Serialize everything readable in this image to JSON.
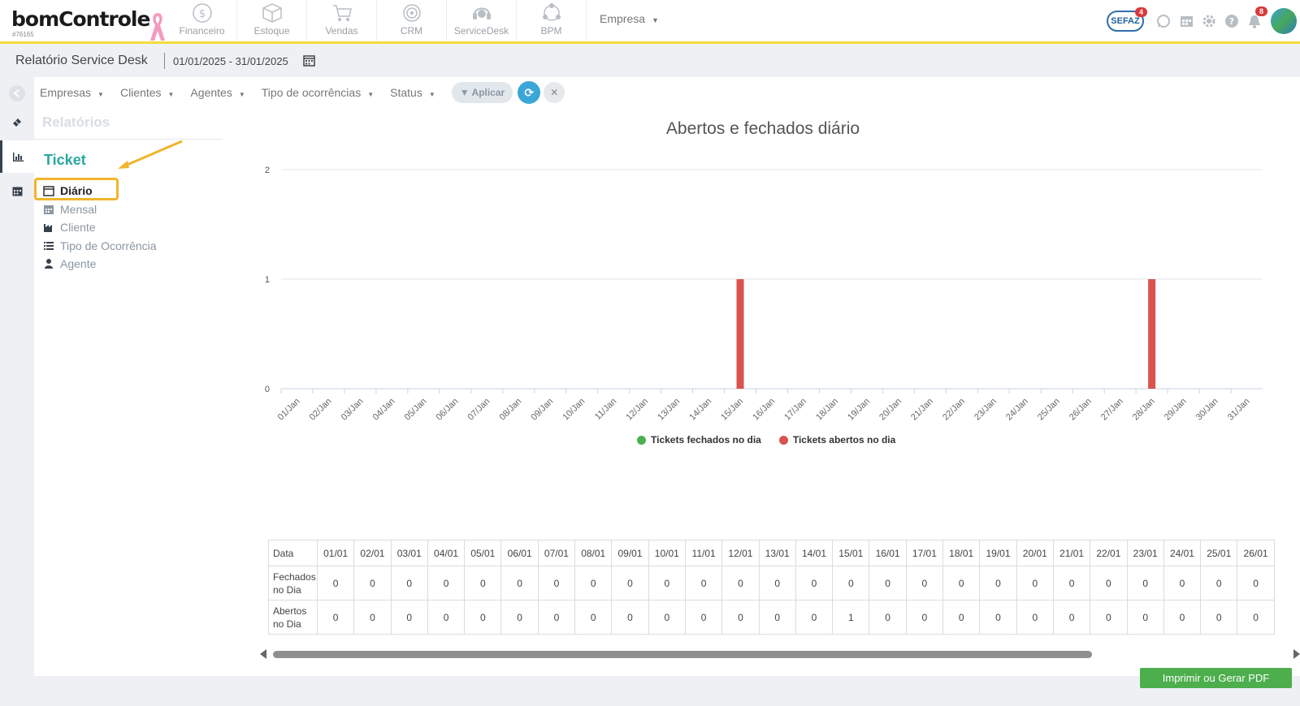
{
  "brand": {
    "logo": "bomControle",
    "account_id": "#76165"
  },
  "modules": [
    {
      "label": "Financeiro",
      "icon": "dollar-circle-icon"
    },
    {
      "label": "Estoque",
      "icon": "box-icon"
    },
    {
      "label": "Vendas",
      "icon": "cart-icon"
    },
    {
      "label": "CRM",
      "icon": "target-icon"
    },
    {
      "label": "ServiceDesk",
      "icon": "headset-icon"
    },
    {
      "label": "BPM",
      "icon": "bpm-icon"
    }
  ],
  "empresa_label": "Empresa",
  "top_icons": {
    "sefaz_label": "SEFAZ",
    "sefaz_badge": "4",
    "notifications_badge": "8"
  },
  "header": {
    "title": "Relatório Service Desk",
    "date_range": "01/01/2025 - 31/01/2025"
  },
  "filters": [
    "Empresas",
    "Clientes",
    "Agentes",
    "Tipo de ocorrências",
    "Status"
  ],
  "apply_label": "Aplicar",
  "sidebar": {
    "section": "Relatórios",
    "group": "Ticket",
    "items": [
      {
        "label": "Diário",
        "icon": "calendar-day-icon",
        "active": true
      },
      {
        "label": "Mensal",
        "icon": "calendar-icon",
        "active": false
      },
      {
        "label": "Cliente",
        "icon": "industry-icon",
        "active": false
      },
      {
        "label": "Tipo de Ocorrência",
        "icon": "list-icon",
        "active": false
      },
      {
        "label": "Agente",
        "icon": "user-icon",
        "active": false
      }
    ]
  },
  "chart_data": {
    "type": "bar",
    "title": "Abertos e fechados diário",
    "categories": [
      "01/Jan",
      "02/Jan",
      "03/Jan",
      "04/Jan",
      "05/Jan",
      "06/Jan",
      "07/Jan",
      "08/Jan",
      "09/Jan",
      "10/Jan",
      "11/Jan",
      "12/Jan",
      "13/Jan",
      "14/Jan",
      "15/Jan",
      "16/Jan",
      "17/Jan",
      "18/Jan",
      "19/Jan",
      "20/Jan",
      "21/Jan",
      "22/Jan",
      "23/Jan",
      "24/Jan",
      "25/Jan",
      "26/Jan",
      "27/Jan",
      "28/Jan",
      "29/Jan",
      "30/Jan",
      "31/Jan"
    ],
    "series": [
      {
        "name": "Tickets fechados no dia",
        "color": "#4caf50",
        "values": [
          0,
          0,
          0,
          0,
          0,
          0,
          0,
          0,
          0,
          0,
          0,
          0,
          0,
          0,
          0,
          0,
          0,
          0,
          0,
          0,
          0,
          0,
          0,
          0,
          0,
          0,
          0,
          0,
          0,
          0,
          0
        ]
      },
      {
        "name": "Tickets abertos no dia",
        "color": "#d9534f",
        "values": [
          0,
          0,
          0,
          0,
          0,
          0,
          0,
          0,
          0,
          0,
          0,
          0,
          0,
          0,
          1,
          0,
          0,
          0,
          0,
          0,
          0,
          0,
          0,
          0,
          0,
          0,
          0,
          1,
          0,
          0,
          0
        ]
      }
    ],
    "yticks": [
      "0",
      "1",
      "2"
    ],
    "ylim": [
      0,
      2
    ],
    "grid": true,
    "legend": "bottom"
  },
  "table": {
    "header_label": "Data",
    "dates": [
      "01/01",
      "02/01",
      "03/01",
      "04/01",
      "05/01",
      "06/01",
      "07/01",
      "08/01",
      "09/01",
      "10/01",
      "11/01",
      "12/01",
      "13/01",
      "14/01",
      "15/01",
      "16/01",
      "17/01",
      "18/01",
      "19/01",
      "20/01",
      "21/01",
      "22/01",
      "23/01",
      "24/01",
      "25/01",
      "26/01"
    ],
    "rows": [
      {
        "label": "Fechados no Dia",
        "values": [
          0,
          0,
          0,
          0,
          0,
          0,
          0,
          0,
          0,
          0,
          0,
          0,
          0,
          0,
          0,
          0,
          0,
          0,
          0,
          0,
          0,
          0,
          0,
          0,
          0,
          0
        ]
      },
      {
        "label": "Abertos no Dia",
        "values": [
          0,
          0,
          0,
          0,
          0,
          0,
          0,
          0,
          0,
          0,
          0,
          0,
          0,
          0,
          1,
          0,
          0,
          0,
          0,
          0,
          0,
          0,
          0,
          0,
          0,
          0
        ]
      }
    ]
  },
  "pdf_button_label": "Imprimir ou Gerar PDF"
}
